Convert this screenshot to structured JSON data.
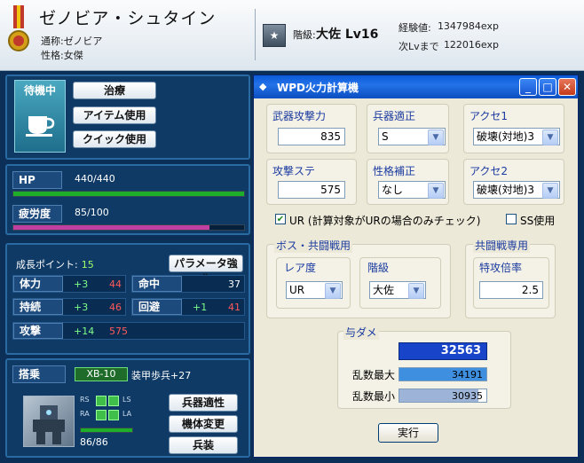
{
  "header": {
    "name": "ゼノビア・シュタイン",
    "alias_label": "通称:",
    "alias": "ゼノビア",
    "personality_label": "性格:",
    "personality": "女傑",
    "rank_label": "階級:",
    "rank": "大佐 Lv16",
    "exp_label": "経験値:",
    "exp": "1347984exp",
    "next_label": "次Lvまで",
    "next": "122016exp"
  },
  "status_panel": {
    "state": "待機中",
    "buttons": [
      "治療",
      "アイテム使用",
      "クイック使用"
    ]
  },
  "vitals": {
    "hp_label": "HP",
    "hp": "440/440",
    "hp_fraction": 1.0,
    "fatigue_label": "疲労度",
    "fatigue": "85/100",
    "fatigue_fraction": 0.85
  },
  "growth": {
    "points_label": "成長ポイント:",
    "points": "15",
    "enhance_button": "パラメータ強化",
    "stats": [
      {
        "label": "体力",
        "bonus": "+3",
        "value": "44"
      },
      {
        "label": "命中",
        "bonus": "",
        "value": "37"
      },
      {
        "label": "持続",
        "bonus": "+3",
        "value": "46"
      },
      {
        "label": "回避",
        "bonus": "+1",
        "value": "41"
      },
      {
        "label": "攻撃",
        "bonus": "+14",
        "value": "575"
      }
    ]
  },
  "mount": {
    "label": "搭乗",
    "unit": "XB-10",
    "unit_name": "装甲歩兵+27",
    "slots": [
      "RS",
      "LS",
      "RA",
      "LA"
    ],
    "durability": "86/86",
    "buttons": [
      "兵器適性",
      "機体変更",
      "兵装"
    ]
  },
  "dialog": {
    "title": "WPD火力計算機",
    "weapon_attack_label": "武器攻撃力",
    "weapon_attack": "835",
    "weapon_apt_label": "兵器適正",
    "weapon_apt": "S",
    "acc1_label": "アクセ1",
    "acc1": "破壊(対地)3",
    "atk_stat_label": "攻撃ステ",
    "atk_stat": "575",
    "personality_mod_label": "性格補正",
    "personality_mod": "なし",
    "acc2_label": "アクセ2",
    "acc2": "破壊(対地)3",
    "ur_check_label": "UR (計算対象がURの場合のみチェック)",
    "ss_check_label": "SS使用",
    "boss_group": "ボス・共闘戦用",
    "rarity_label": "レア度",
    "rarity": "UR",
    "rank_label": "階級",
    "rank": "大佐",
    "coop_group": "共闘戦専用",
    "special_label": "特攻倍率",
    "special": "2.5",
    "damage_group": "与ダメ",
    "damage": "32563",
    "max_label": "乱数最大",
    "max": "34191",
    "min_label": "乱数最小",
    "min": "30935",
    "run_button": "実行"
  },
  "colors": {
    "hp_bar": "#1fae2a",
    "fatigue_bar": "#c03fa0",
    "damage_box": "#1744c8",
    "max_bar": "#3e8fe0",
    "min_bar": "#9db4d8"
  }
}
